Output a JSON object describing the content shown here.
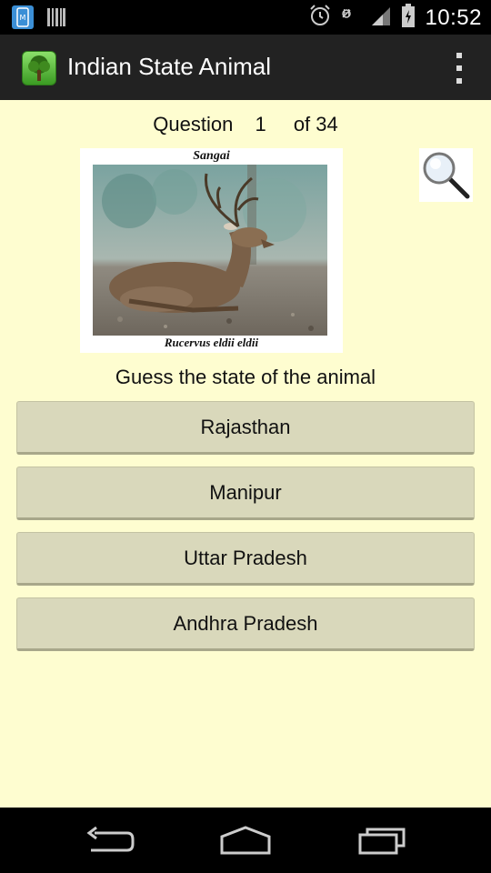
{
  "status_bar": {
    "time": "10:52",
    "icons": [
      "notification-app-icon",
      "barcode-icon",
      "alarm-icon",
      "no-signal-h-icon",
      "signal-icon",
      "battery-icon"
    ]
  },
  "action_bar": {
    "title": "Indian State Animal",
    "app_icon": "tree-icon",
    "menu_icon": "overflow-menu-icon"
  },
  "quiz": {
    "question_label": "Question",
    "question_number": "1",
    "question_total": "of 34",
    "animal_name": "Sangai",
    "scientific_name": "Rucervus eldii eldii",
    "prompt": "Guess the state of the animal",
    "options": [
      "Rajasthan",
      "Manipur",
      "Uttar Pradesh",
      "Andhra Pradesh"
    ],
    "zoom_icon": "magnifier-icon"
  },
  "nav_bar": {
    "icons": [
      "back-icon",
      "home-icon",
      "recents-icon"
    ]
  },
  "colors": {
    "background": "#fefdd0",
    "button": "#d9d8bb",
    "action_bar": "#222222"
  }
}
